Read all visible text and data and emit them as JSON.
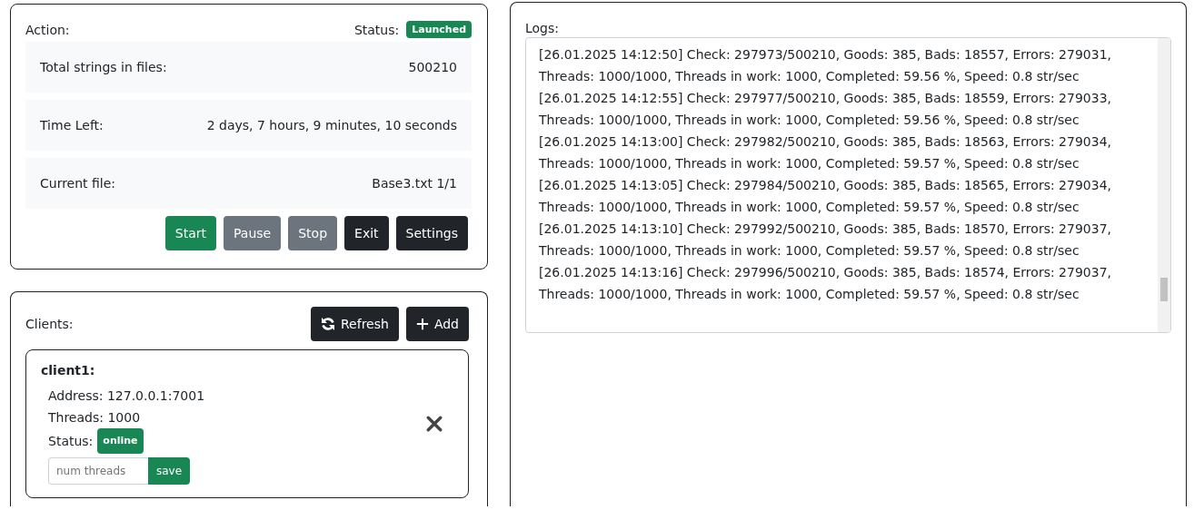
{
  "action_panel": {
    "title": "Action:",
    "status_label": "Status:",
    "status_badge": "Launched",
    "stats": [
      {
        "label": "Total strings in files:",
        "value": "500210"
      },
      {
        "label": "Time Left:",
        "value": "2 days, 7 hours, 9 minutes, 10 seconds"
      },
      {
        "label": "Current file:",
        "value": "Base3.txt 1/1"
      }
    ],
    "buttons": [
      {
        "label": "Start",
        "kind": "success"
      },
      {
        "label": "Pause",
        "kind": "secondary"
      },
      {
        "label": "Stop",
        "kind": "secondary"
      },
      {
        "label": "Exit",
        "kind": "dark"
      },
      {
        "label": "Settings",
        "kind": "dark"
      }
    ]
  },
  "clients_panel": {
    "title": "Clients:",
    "buttons": [
      {
        "label": "Refresh",
        "kind": "refresh"
      },
      {
        "label": "Add",
        "kind": "add"
      }
    ],
    "clients": [
      {
        "name": "client1:",
        "address": "Address: 127.0.0.1:7001",
        "threads": "Threads: 1000",
        "status_label": "Status:",
        "status_badge": "online",
        "input_placeholder": "num threads",
        "save_button": "save"
      }
    ]
  },
  "logs_panel": {
    "title": "Logs:",
    "lines": [
      "[26.01.2025 14:12:50] Check: 297973/500210, Goods: 385, Bads: 18557, Errors: 279031, Threads: 1000/1000, Threads in work: 1000, Completed: 59.56 %, Speed: 0.8 str/sec",
      "[26.01.2025 14:12:55] Check: 297977/500210, Goods: 385, Bads: 18559, Errors: 279033, Threads: 1000/1000, Threads in work: 1000, Completed: 59.56 %, Speed: 0.8 str/sec",
      "[26.01.2025 14:13:00] Check: 297982/500210, Goods: 385, Bads: 18563, Errors: 279034, Threads: 1000/1000, Threads in work: 1000, Completed: 59.57 %, Speed: 0.8 str/sec",
      "[26.01.2025 14:13:05] Check: 297984/500210, Goods: 385, Bads: 18565, Errors: 279034, Threads: 1000/1000, Threads in work: 1000, Completed: 59.57 %, Speed: 0.8 str/sec",
      "[26.01.2025 14:13:10] Check: 297992/500210, Goods: 385, Bads: 18570, Errors: 279037, Threads: 1000/1000, Threads in work: 1000, Completed: 59.57 %, Speed: 0.8 str/sec",
      "[26.01.2025 14:13:16] Check: 297996/500210, Goods: 385, Bads: 18574, Errors: 279037, Threads: 1000/1000, Threads in work: 1000, Completed: 59.57 %, Speed: 0.8 str/sec"
    ]
  }
}
